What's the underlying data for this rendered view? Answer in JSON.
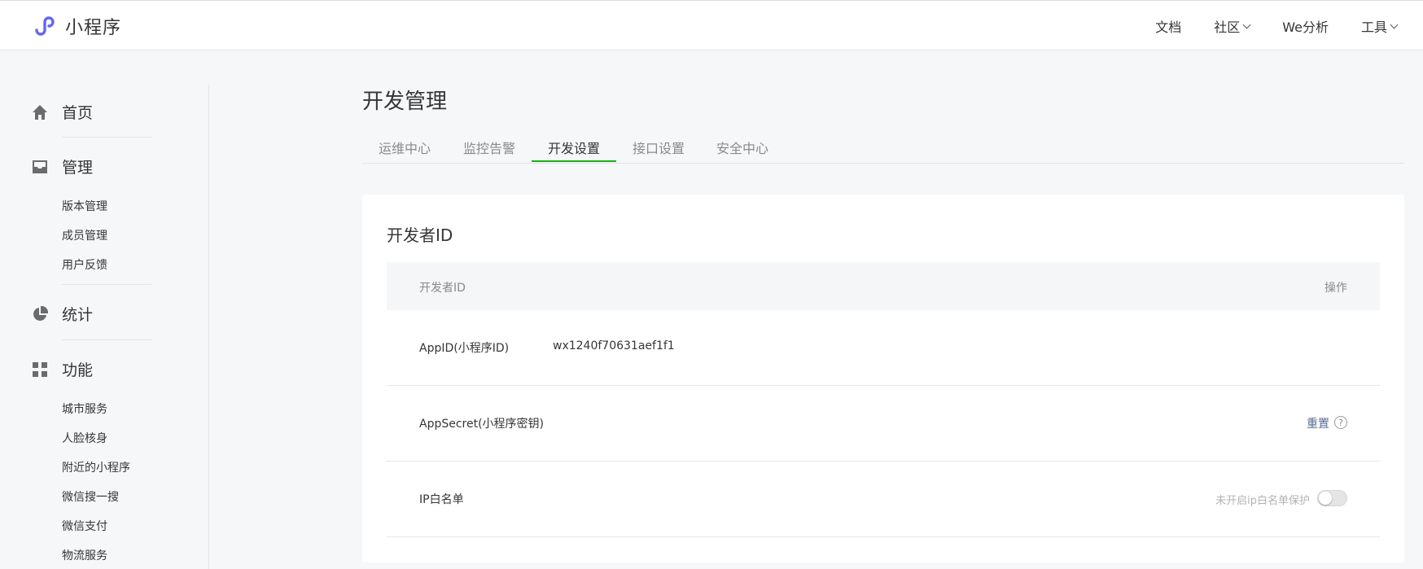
{
  "header": {
    "logo_text": "小程序",
    "nav": [
      {
        "label": "文档",
        "has_dropdown": false
      },
      {
        "label": "社区",
        "has_dropdown": true
      },
      {
        "label": "We分析",
        "has_dropdown": false
      },
      {
        "label": "工具",
        "has_dropdown": true
      }
    ]
  },
  "sidebar": {
    "groups": [
      {
        "label": "首页",
        "icon": "home-icon"
      },
      {
        "label": "管理",
        "icon": "inbox-icon",
        "items": [
          "版本管理",
          "成员管理",
          "用户反馈"
        ]
      },
      {
        "label": "统计",
        "icon": "pie-chart-icon"
      },
      {
        "label": "功能",
        "icon": "grid-icon",
        "items": [
          "城市服务",
          "人脸核身",
          "附近的小程序",
          "微信搜一搜",
          "微信支付",
          "物流服务"
        ]
      }
    ]
  },
  "main": {
    "title": "开发管理",
    "tabs": [
      "运维中心",
      "监控告警",
      "开发设置",
      "接口设置",
      "安全中心"
    ],
    "active_tab": "开发设置",
    "card": {
      "title": "开发者ID",
      "table": {
        "headers": [
          "开发者ID",
          "操作"
        ],
        "rows": [
          {
            "label": "AppID(小程序ID)",
            "value": "wx1240f70631aef1f1"
          },
          {
            "label": "AppSecret(小程序密钥)",
            "action": "重置",
            "help": "?"
          },
          {
            "label": "IP白名单",
            "status": "未开启ip白名单保护",
            "toggle_on": false
          }
        ]
      }
    }
  },
  "colors": {
    "accent": "#1aad19",
    "link": "#576b95",
    "logo": "#6467f0"
  }
}
